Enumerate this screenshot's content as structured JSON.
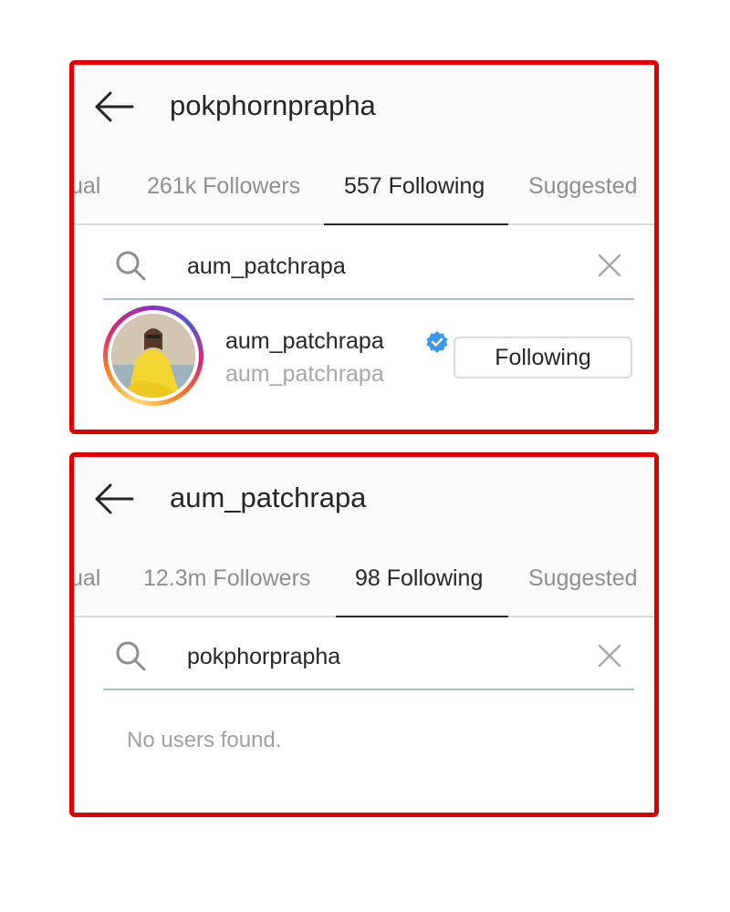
{
  "panels": [
    {
      "title": "pokphornprapha",
      "tabs": [
        "ual",
        "261k Followers",
        "557 Following",
        "Suggested"
      ],
      "active_tab": "557 Following",
      "search": {
        "value": "aum_patchrapa"
      },
      "result": {
        "username": "aum_patchrapa",
        "verified": true,
        "full_name": "aum_patchrapa",
        "button_label": "Following"
      }
    },
    {
      "title": "aum_patchrapa",
      "tabs": [
        "ual",
        "12.3m Followers",
        "98 Following",
        "Suggested"
      ],
      "active_tab": "98 Following",
      "search": {
        "value": "pokphorprapha"
      },
      "empty_message": "No users found."
    }
  ],
  "icons": {
    "back": "arrow-left-icon",
    "search": "search-icon",
    "clear": "close-icon",
    "verified": "verified-badge-icon"
  },
  "colors": {
    "highlight_border": "#e00000",
    "verified_blue": "#3897f0",
    "text_primary": "#262626",
    "text_secondary": "#8e8e8e"
  }
}
